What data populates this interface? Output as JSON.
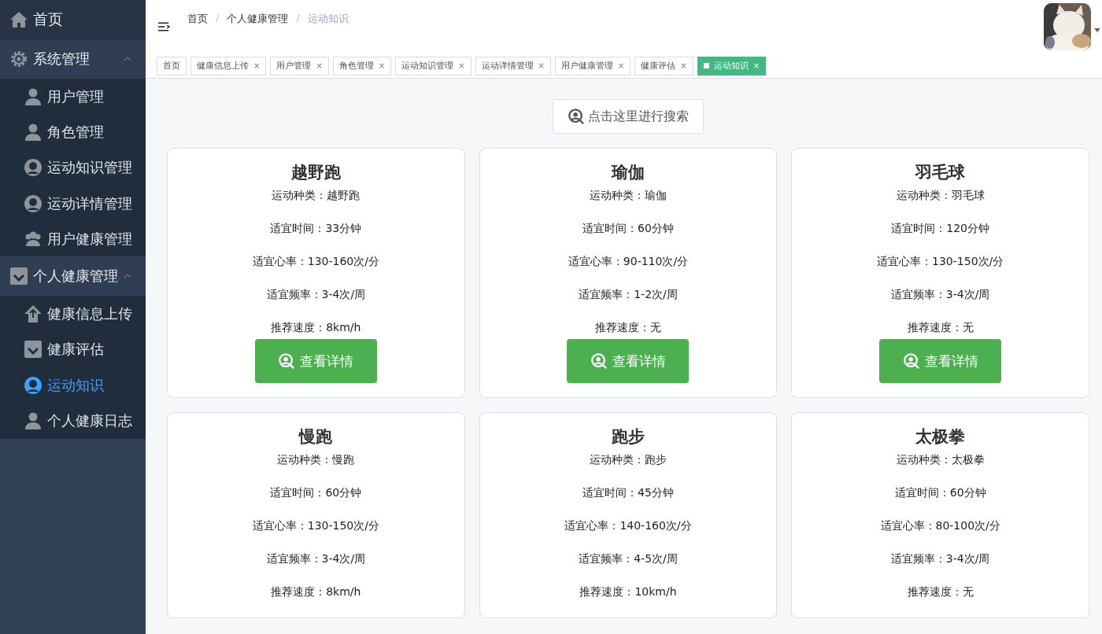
{
  "sidebar": {
    "items": [
      {
        "kind": "link",
        "label": "首页",
        "selected": false
      },
      {
        "kind": "group",
        "label": "系统管理",
        "expanded": true,
        "children": [
          {
            "label": "用户管理",
            "selected": false
          },
          {
            "label": "角色管理",
            "selected": false
          },
          {
            "label": "运动知识管理",
            "selected": false
          },
          {
            "label": "运动详情管理",
            "selected": false
          },
          {
            "label": "用户健康管理",
            "selected": false
          }
        ]
      },
      {
        "kind": "group",
        "label": "个人健康管理",
        "expanded": true,
        "children": [
          {
            "label": "健康信息上传",
            "selected": false
          },
          {
            "label": "健康评估",
            "selected": false
          },
          {
            "label": "运动知识",
            "selected": true
          },
          {
            "label": "个人健康日志",
            "selected": false
          }
        ]
      }
    ]
  },
  "breadcrumb": [
    "首页",
    "个人健康管理",
    "运动知识"
  ],
  "breadcrumb_separator": "/",
  "avatar": {
    "kind": "picture"
  },
  "tabs": [
    {
      "label": "首页",
      "closable": false,
      "selected": false
    },
    {
      "label": "健康信息上传",
      "closable": true,
      "selected": false
    },
    {
      "label": "用户管理",
      "closable": true,
      "selected": false
    },
    {
      "label": "角色管理",
      "closable": true,
      "selected": false
    },
    {
      "label": "运动知识管理",
      "closable": true,
      "selected": false
    },
    {
      "label": "运动详情管理",
      "closable": true,
      "selected": false
    },
    {
      "label": "用户健康管理",
      "closable": true,
      "selected": false
    },
    {
      "label": "健康评估",
      "closable": true,
      "selected": false
    },
    {
      "label": "运动知识",
      "closable": true,
      "selected": true
    }
  ],
  "tab_close": "×",
  "search_button": "点击这里进行搜索",
  "cards": [
    {
      "title": "越野跑",
      "lines": [
        "运动种类：越野跑",
        "适宜时间：33分钟",
        "适宜心率：130-160次/分",
        "适宜频率：3-4次/周",
        "推荐速度：8km/h"
      ],
      "button": "查看详情"
    },
    {
      "title": "瑜伽",
      "lines": [
        "运动种类：瑜伽",
        "适宜时间：60分钟",
        "适宜心率：90-110次/分",
        "适宜频率：1-2次/周",
        "推荐速度：无"
      ],
      "button": "查看详情"
    },
    {
      "title": "羽毛球",
      "lines": [
        "运动种类：羽毛球",
        "适宜时间：120分钟",
        "适宜心率：130-150次/分",
        "适宜频率：3-4次/周",
        "推荐速度：无"
      ],
      "button": "查看详情"
    },
    {
      "title": "慢跑",
      "lines": [
        "运动种类：慢跑",
        "适宜时间：60分钟",
        "适宜心率：130-150次/分",
        "适宜频率：3-4次/周",
        "推荐速度：8km/h"
      ]
    },
    {
      "title": "跑步",
      "lines": [
        "运动种类：跑步",
        "适宜时间：45分钟",
        "适宜心率：140-160次/分",
        "适宜频率：4-5次/周",
        "推荐速度：10km/h"
      ]
    },
    {
      "title": "太极拳",
      "lines": [
        "运动种类：太极拳",
        "适宜时间：60分钟",
        "适宜心率：80-100次/分",
        "适宜频率：3-4次/周",
        "推荐速度：无"
      ]
    }
  ]
}
